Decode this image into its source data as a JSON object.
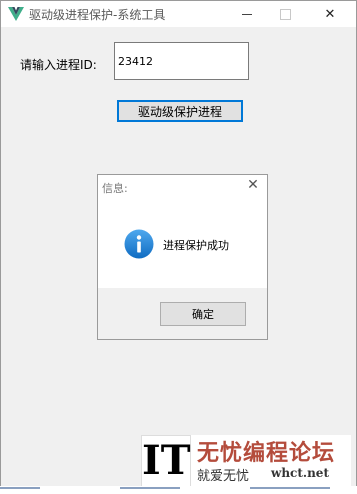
{
  "window": {
    "title": "驱动级进程保护-系统工具",
    "controls": {
      "minimize": "",
      "maximize": "",
      "close": "✕"
    }
  },
  "form": {
    "pid_label": "请输入进程ID:",
    "pid_value": "23412",
    "protect_button": "驱动级保护进程"
  },
  "dialog": {
    "title": "信息:",
    "close": "✕",
    "icon": "info-icon",
    "message": "进程保护成功",
    "ok_button": "确定"
  },
  "watermark": {
    "logo_text": "IT",
    "site_name": "无忧编程论坛",
    "slogan": "就爱无忧",
    "domain": "whct.net"
  },
  "colors": {
    "accent": "#0078d7",
    "info_icon": "#1a7fd4",
    "watermark_red": "#b44c3c"
  }
}
